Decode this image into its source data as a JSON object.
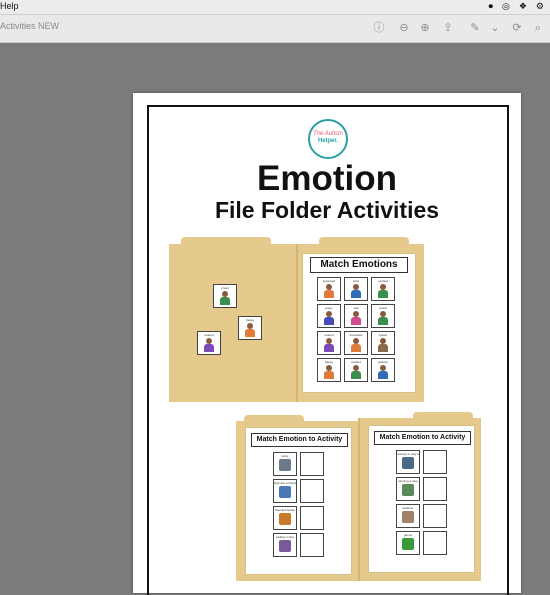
{
  "menubar": {
    "menu_help": "Help"
  },
  "toolbar": {
    "doc_title": "Activities NEW"
  },
  "document": {
    "logo_line1": "The Autism",
    "logo_line2": "Helper.",
    "title": "Emotion",
    "subtitle": "File Folder Activities"
  },
  "folder1": {
    "sheet_title": "Match Emotions",
    "loose_cards": [
      {
        "label": "proud"
      },
      {
        "label": "happy"
      },
      {
        "label": "scared"
      }
    ],
    "grid_cards": [
      {
        "label": "surprised",
        "shirt": "#e07b3a"
      },
      {
        "label": "tired",
        "shirt": "#2f6db5"
      },
      {
        "label": "excited",
        "shirt": "#3a8f4e"
      },
      {
        "label": "angry",
        "shirt": "#4a4ab8"
      },
      {
        "label": "sad",
        "shirt": "#d14a8c"
      },
      {
        "label": "proud",
        "shirt": "#3a8f4e"
      },
      {
        "label": "scared",
        "shirt": "#7b4ab8"
      },
      {
        "label": "frustrated",
        "shirt": "#e07b3a"
      },
      {
        "label": "bored",
        "shirt": "#8a6a4a"
      },
      {
        "label": "happy",
        "shirt": "#e07b3a"
      },
      {
        "label": "excited",
        "shirt": "#3a8f4e"
      },
      {
        "label": "jealous",
        "shirt": "#2f6db5"
      }
    ]
  },
  "folder2": {
    "sheet_title": "Match Emotion to Activity",
    "activities": [
      {
        "label": "party",
        "color": "#6a7a8a"
      },
      {
        "label": "high five a friend",
        "color": "#4a7ab5"
      },
      {
        "label": "haunted house",
        "color": "#c77a2a"
      },
      {
        "label": "waiting in line",
        "color": "#7a5a9a"
      }
    ]
  },
  "folder3": {
    "sheet_title": "Match Emotion to Activity",
    "activities": [
      {
        "label": "nobody to play with",
        "color": "#4a6a8a"
      },
      {
        "label": "winning a race",
        "color": "#5a8a5a"
      },
      {
        "label": "bedtime",
        "color": "#a0826a"
      },
      {
        "label": "germs",
        "color": "#3a9a3a"
      }
    ]
  }
}
